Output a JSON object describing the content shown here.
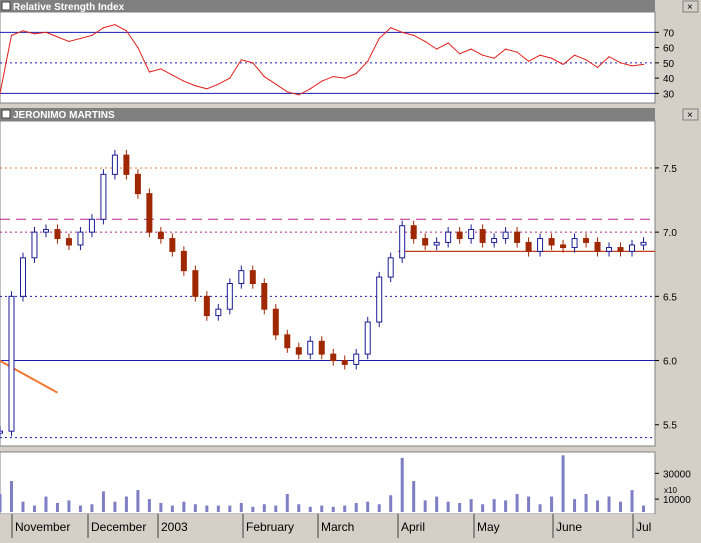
{
  "panels": {
    "rsi_title": "Relative Strength Index",
    "price_title": "JERONIMO MARTINS",
    "volume_multiplier": "x10"
  },
  "x_axis_labels": [
    "November",
    "December",
    "2003",
    "February",
    "March",
    "April",
    "May",
    "June",
    "Jul"
  ],
  "colors": {
    "panel_bg": "#ffffff",
    "chrome": "#d4d0c8",
    "title_bar": "#808080",
    "rsi_line": "#e0201c",
    "guide_blue": "#1c1cb4",
    "guide_orange": "#e8783c",
    "guide_magenta": "#b4288c",
    "candle_up": "#1c1c96",
    "candle_down": "#a02800",
    "volume_bar": "#7e7ec4",
    "trendline": "#f07830",
    "support": "#c03c1c"
  },
  "chart_data": [
    {
      "type": "line",
      "title": "Relative Strength Index",
      "ylim": [
        25,
        82
      ],
      "yticks": [
        30,
        40,
        50,
        60,
        70
      ],
      "reference_lines": [
        {
          "value": 70,
          "style": "solid",
          "color": "blue"
        },
        {
          "value": 50,
          "style": "dotted",
          "color": "blue"
        },
        {
          "value": 30,
          "style": "solid",
          "color": "blue"
        }
      ],
      "x_range": [
        0,
        171
      ],
      "series": [
        {
          "x": [
            0,
            3,
            6,
            9,
            12,
            15,
            18,
            21,
            24,
            27,
            30,
            33,
            36,
            39,
            42,
            45,
            48,
            51,
            54,
            57,
            60,
            63,
            66,
            69,
            72,
            75,
            78,
            81,
            84,
            87,
            90,
            93,
            96,
            99,
            102,
            105,
            108,
            111,
            114,
            117,
            120,
            123,
            126,
            129,
            132,
            135,
            138,
            141,
            144,
            147,
            150,
            153,
            156,
            159,
            162,
            165,
            168
          ],
          "values": [
            30,
            68,
            71,
            69,
            70,
            67,
            64,
            66,
            68,
            73,
            75,
            71,
            60,
            44,
            46,
            42,
            38,
            35,
            33,
            36,
            40,
            52,
            50,
            41,
            36,
            31,
            29,
            33,
            38,
            41,
            40,
            43,
            51,
            66,
            73,
            70,
            68,
            64,
            59,
            63,
            56,
            59,
            55,
            53,
            59,
            57,
            51,
            55,
            53,
            49,
            55,
            52,
            47,
            54,
            50,
            48,
            49
          ]
        }
      ]
    },
    {
      "type": "candlestick",
      "title": "JERONIMO MARTINS",
      "ylim": [
        5.35,
        7.85
      ],
      "yticks": [
        5.5,
        6.0,
        6.5,
        7.0,
        7.5
      ],
      "reference_lines": [
        {
          "value": 7.5,
          "style": "dotted",
          "color": "orange"
        },
        {
          "value": 7.1,
          "style": "dashed",
          "color": "magenta"
        },
        {
          "value": 7.0,
          "style": "dotted",
          "color": "magenta"
        },
        {
          "value": 6.5,
          "style": "dotted",
          "color": "blue"
        },
        {
          "value": 6.0,
          "style": "solid",
          "color": "blue"
        },
        {
          "value": 5.4,
          "style": "dotted",
          "color": "blue"
        }
      ],
      "support_line": {
        "value": 6.85,
        "from_x": 104,
        "to_x": 171
      },
      "trendline": {
        "x1": -2,
        "y1": 6.03,
        "x2": 15,
        "y2": 5.75
      },
      "x_range": [
        0,
        171
      ],
      "x": [
        0,
        3,
        6,
        9,
        12,
        15,
        18,
        21,
        24,
        27,
        30,
        33,
        36,
        39,
        42,
        45,
        48,
        51,
        54,
        57,
        60,
        63,
        66,
        69,
        72,
        75,
        78,
        81,
        84,
        87,
        90,
        93,
        96,
        99,
        102,
        105,
        108,
        111,
        114,
        117,
        120,
        123,
        126,
        129,
        132,
        135,
        138,
        141,
        144,
        147,
        150,
        153,
        156,
        159,
        162,
        165,
        168
      ],
      "close": [
        5.45,
        6.5,
        6.8,
        7.0,
        7.02,
        6.95,
        6.9,
        7.0,
        7.1,
        7.45,
        7.6,
        7.45,
        7.3,
        7.0,
        6.95,
        6.85,
        6.7,
        6.5,
        6.35,
        6.4,
        6.6,
        6.7,
        6.6,
        6.4,
        6.2,
        6.1,
        6.05,
        6.15,
        6.05,
        6.0,
        5.97,
        6.05,
        6.3,
        6.65,
        6.8,
        7.05,
        6.95,
        6.9,
        6.92,
        7.0,
        6.95,
        7.02,
        6.92,
        6.95,
        7.0,
        6.92,
        6.85,
        6.95,
        6.9,
        6.88,
        6.95,
        6.92,
        6.85,
        6.88,
        6.85,
        6.9,
        6.92
      ]
    },
    {
      "type": "bar",
      "title": "",
      "ylim": [
        0,
        45000
      ],
      "yticks": [
        10000,
        30000
      ],
      "x_range": [
        0,
        171
      ],
      "x": [
        0,
        3,
        6,
        9,
        12,
        15,
        18,
        21,
        24,
        27,
        30,
        33,
        36,
        39,
        42,
        45,
        48,
        51,
        54,
        57,
        60,
        63,
        66,
        69,
        72,
        75,
        78,
        81,
        84,
        87,
        90,
        93,
        96,
        99,
        102,
        105,
        108,
        111,
        114,
        117,
        120,
        123,
        126,
        129,
        132,
        135,
        138,
        141,
        144,
        147,
        150,
        153,
        156,
        159,
        162,
        165,
        168
      ],
      "values": [
        14000,
        24000,
        8000,
        5000,
        12000,
        7000,
        9000,
        5000,
        6000,
        16000,
        8000,
        12000,
        17000,
        10000,
        7000,
        5000,
        8000,
        6000,
        5000,
        5000,
        5000,
        7000,
        4000,
        6000,
        5000,
        14000,
        6000,
        4000,
        5000,
        4000,
        5000,
        7000,
        8000,
        6000,
        13000,
        42000,
        24000,
        9000,
        12000,
        8000,
        7000,
        10000,
        6000,
        10000,
        9000,
        14000,
        12000,
        6000,
        12000,
        44000,
        10000,
        14000,
        9000,
        12000,
        8000,
        17000,
        5000
      ]
    }
  ]
}
